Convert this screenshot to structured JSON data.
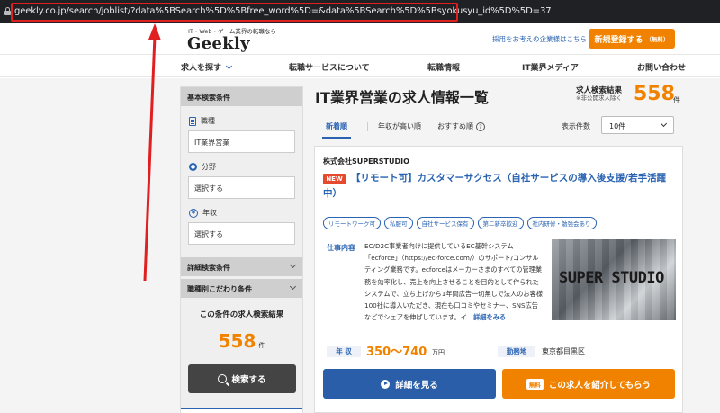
{
  "browser": {
    "url": "geekly.co.jp/search/joblist/?data%5BSearch%5D%5Bfree_word%5D=&data%5BSearch%5D%5Bsyokusyu_id%5D%5D=37"
  },
  "header": {
    "tagline": "IT・Web・ゲーム業界の転職なら",
    "logo": "Geekly",
    "corp_link": "採用をお考えの企業様はこちら",
    "signup_label": "新規登録する",
    "signup_sub": "（無料）"
  },
  "nav": {
    "items": [
      "求人を探す",
      "転職サービスについて",
      "転職情報",
      "IT業界メディア",
      "お問い合わせ"
    ]
  },
  "sidebar": {
    "basic_title": "基本検索条件",
    "job_type_label": "職種",
    "job_type_value": "IT業界営業",
    "area_label": "分野",
    "area_value": "選択する",
    "salary_label": "年収",
    "salary_value": "選択する",
    "detail_title": "詳細検索条件",
    "preference_title": "職種別こだわり条件",
    "result_label": "この条件の求人検索結果",
    "result_count": "558",
    "result_unit": "件",
    "search_button": "検索する"
  },
  "main": {
    "title": "IT業界営業の求人情報一覧",
    "count_label": "求人検索結果",
    "count_sub": "※非公開求人除く",
    "count": "558",
    "count_unit": "件",
    "sort_tabs": [
      "新着順",
      "年収が高い順",
      "おすすめ順"
    ],
    "per_page_label": "表示件数",
    "per_page_value": "10件"
  },
  "job": {
    "company": "株式会社SUPERSTUDIO",
    "badge": "NEW",
    "title_line1": "【リモート可】カスタマーサクセス（自社サービスの導入後支援/若手活躍",
    "title_line2": "中）",
    "tags": [
      "リモートワーク可",
      "私服可",
      "自社サービス保有",
      "第二新卒歓迎",
      "社内研修・勉強会あり"
    ],
    "work_label": "仕事内容",
    "description": "EC/D2C事業者向けに提供しているEC基幹システム「ecforce」（https://ec-force.com/）のサポート/コンサルティング業務です。ecforceはメーカーさまのすべての管理業務を効率化し、売上を向上させることを目的として作られたシステムで、立ち上げから1年間広告一切無しで法人のお客様100社に導入いただき、現在も口コミやセミナー、SNS広告などでシェアを伸ばしています。イ…",
    "more_link": "詳細をみる",
    "image_text": "SUPER STUDIO",
    "salary_label": "年 収",
    "salary_value": "350〜740",
    "salary_unit": "万円",
    "location_label": "勤務地",
    "location_value": "東京都目黒区",
    "detail_button": "詳細を見る",
    "free_badge": "無料",
    "intro_button": "この求人を紹介してもらう"
  },
  "colors": {
    "accent_orange": "#f08200",
    "accent_blue": "#2a63b2",
    "annotation_red": "#e02020"
  }
}
